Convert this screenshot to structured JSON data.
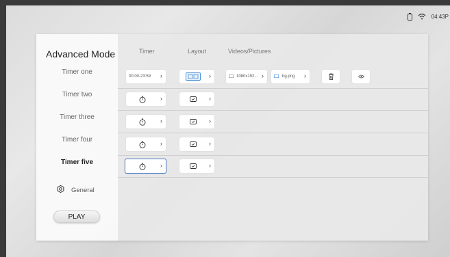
{
  "status": {
    "time": "04:43P"
  },
  "sidebar": {
    "title": "Advanced Mode",
    "timers": [
      {
        "label": "Timer one"
      },
      {
        "label": "Timer two"
      },
      {
        "label": "Timer three"
      },
      {
        "label": "Timer four"
      },
      {
        "label": "Timer five"
      }
    ],
    "general_label": "General",
    "play_label": "PLAY"
  },
  "table": {
    "headers": {
      "timer": "Timer",
      "layout": "Layout",
      "media": "Videos/Pictures"
    },
    "row1": {
      "time_range": "00:00-23:59",
      "video": "1080x192...",
      "picture": "bg.png"
    }
  },
  "icons": {
    "battery": "battery-icon",
    "wifi": "wifi-icon",
    "stopwatch": "stopwatch-icon",
    "layout": "layout-icon",
    "delete": "trash-icon",
    "preview": "eye-icon",
    "general": "gear-icon"
  },
  "colors": {
    "selected_border": "#4a78c4",
    "layout_accent": "#4a90d9"
  }
}
